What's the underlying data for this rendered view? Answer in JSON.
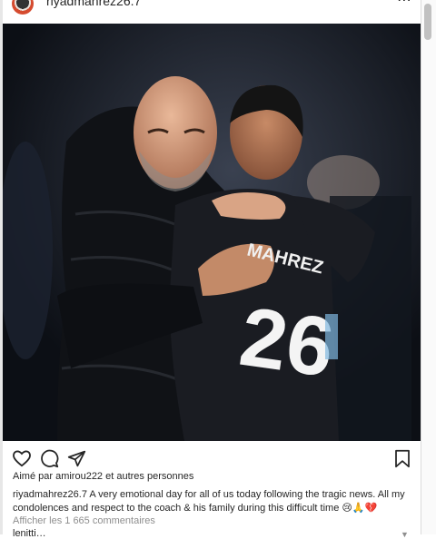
{
  "post": {
    "username": "riyadmahrez26.7",
    "more_icon": "more-horizontal-icon",
    "image_alt": "Pep Guardiola hugging Riyad Mahrez, number 26",
    "jersey_name": "MAHREZ",
    "jersey_number": "26",
    "likes_text": "Aimé par amirou222 et autres personnes",
    "caption_user": "riyadmahrez26.7",
    "caption_text": "A very emotional day for all of us today following the tragic news. All my condolences and respect to the coach & his family during this difficult time 😢🙏💔",
    "comments_link": "Afficher les 1 665 commentaires",
    "cut_text": "lenitti… "
  },
  "actions": {
    "like_icon": "heart-icon",
    "comment_icon": "comment-icon",
    "share_icon": "share-icon",
    "save_icon": "bookmark-icon"
  },
  "colors": {
    "text": "#262626",
    "muted": "#8e8e8e",
    "divider": "#dbdbdb",
    "photo_bg": "#151922"
  }
}
